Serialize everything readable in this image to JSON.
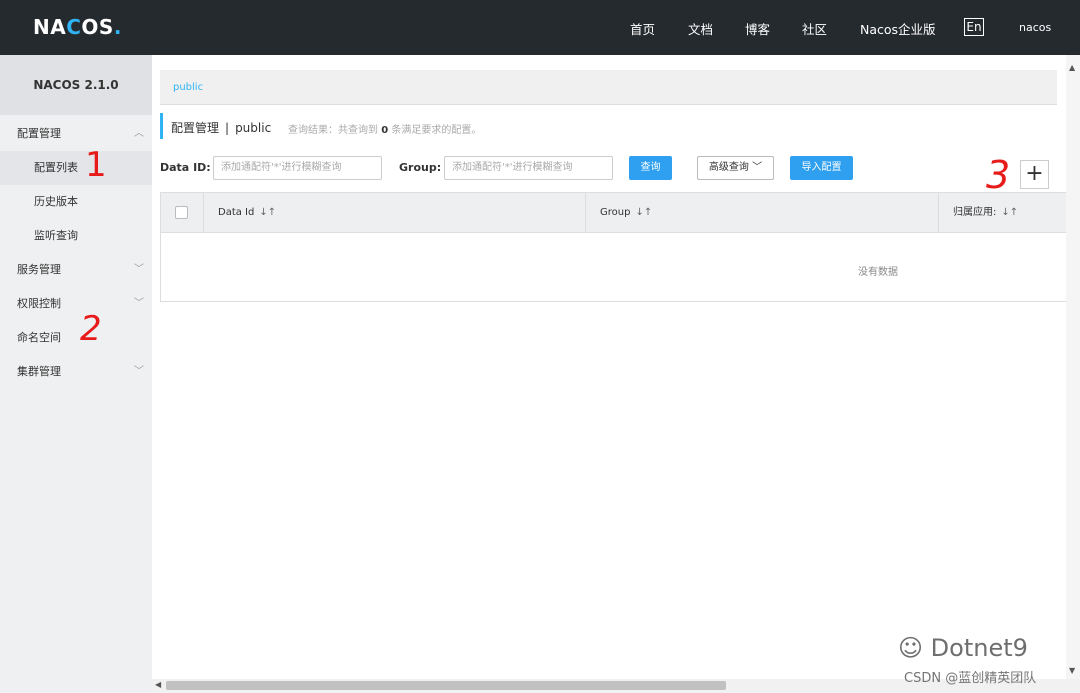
{
  "header": {
    "logo": {
      "prefix": "NA",
      "accent": "C",
      "suffix": "OS",
      "dot": "."
    },
    "nav": [
      "首页",
      "文档",
      "博客",
      "社区",
      "Nacos企业版"
    ],
    "lang": "En",
    "user": "nacos"
  },
  "sidebar": {
    "version": "NACOS 2.1.0",
    "items": [
      {
        "label": "配置管理",
        "expanded": true
      },
      {
        "label": "配置列表",
        "sub": true,
        "active": true
      },
      {
        "label": "历史版本",
        "sub": true
      },
      {
        "label": "监听查询",
        "sub": true
      },
      {
        "label": "服务管理"
      },
      {
        "label": "权限控制"
      },
      {
        "label": "命名空间"
      },
      {
        "label": "集群管理"
      }
    ]
  },
  "main": {
    "namespace": "public",
    "title": "配置管理",
    "separator": "|",
    "current_ns": "public",
    "result_prefix": "查询结果：共查询到",
    "result_count": "0",
    "result_suffix": "条满足要求的配置。",
    "search": {
      "dataid_label": "Data ID:",
      "dataid_placeholder": "添加通配符'*'进行模糊查询",
      "group_label": "Group:",
      "group_placeholder": "添加通配符'*'进行模糊查询",
      "query_btn": "查询",
      "advanced_btn": "高级查询",
      "import_btn": "导入配置",
      "add_btn": "+"
    },
    "table": {
      "columns": [
        "Data Id",
        "Group",
        "归属应用:"
      ],
      "sort_icon": "↓↑",
      "empty_text": "没有数据"
    }
  },
  "annotations": [
    "1",
    "2",
    "3"
  ],
  "watermark": {
    "main": "Dotnet9",
    "sub": "CSDN @蓝创精英团队"
  },
  "colors": {
    "header_bg": "#252a2f",
    "accent": "#2fb3f2",
    "primary_btn": "#2fa0f0",
    "annotation": "#e81b1b"
  }
}
